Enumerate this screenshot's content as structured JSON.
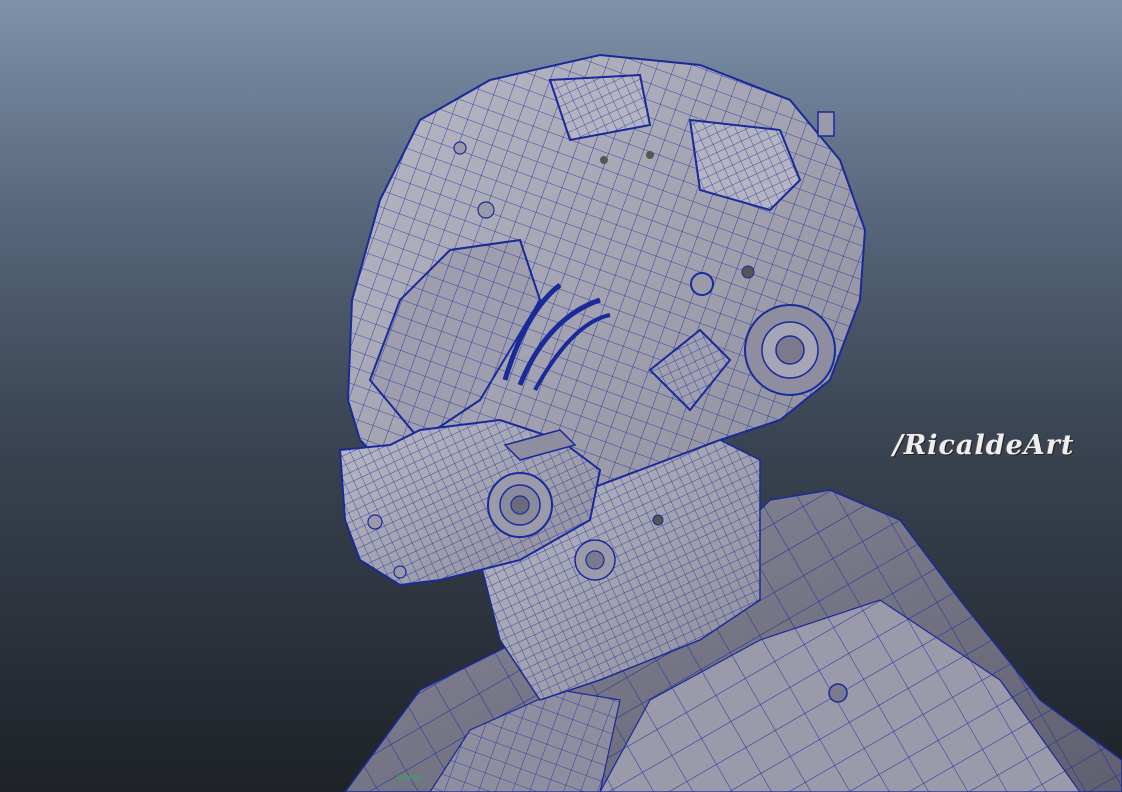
{
  "viewport": {
    "camera_name": "persp",
    "watermark": "/RicaldeArt"
  },
  "colors": {
    "background_top": "#7d91a9",
    "background_bottom": "#1e2228",
    "mesh_fill": "#a9a9b8",
    "mesh_dark": "#6e6e80",
    "wireframe": "#1a2a9a",
    "watermark_text": "#eeeeee",
    "camera_label": "#3aa85a"
  },
  "icons": [
    "wireframe-mesh-icon"
  ]
}
